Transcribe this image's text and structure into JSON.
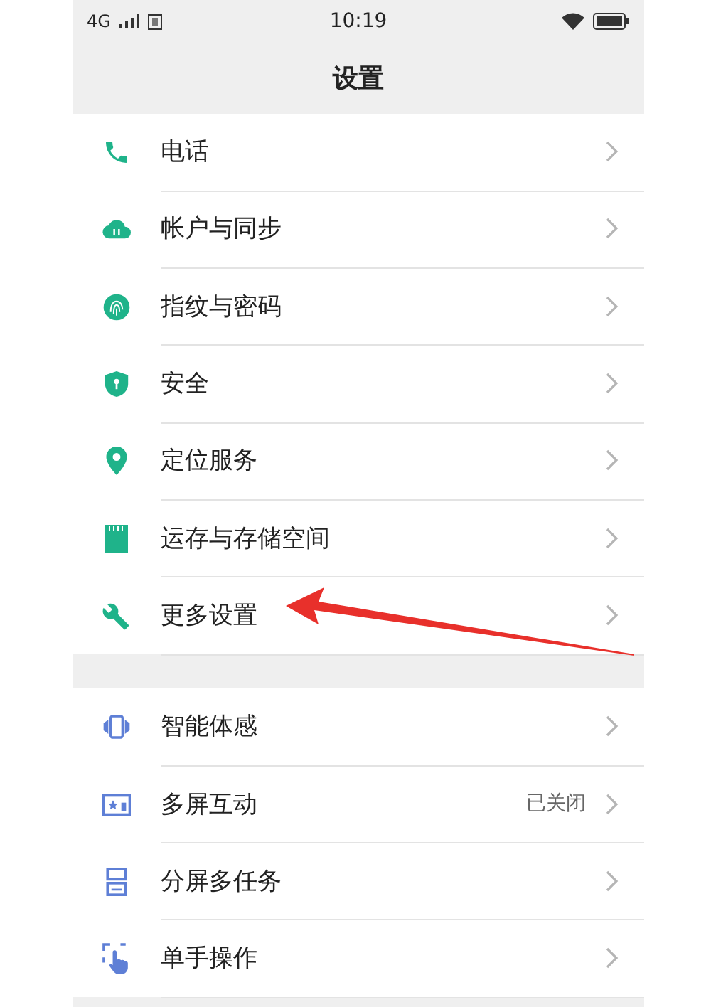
{
  "status_bar": {
    "network": "4G",
    "time": "10:19"
  },
  "title": "设置",
  "groups": [
    {
      "items": [
        {
          "label": "电话"
        },
        {
          "label": "帐户与同步"
        },
        {
          "label": "指纹与密码"
        },
        {
          "label": "安全"
        },
        {
          "label": "定位服务"
        },
        {
          "label": "运存与存储空间"
        },
        {
          "label": "更多设置"
        }
      ]
    },
    {
      "items": [
        {
          "label": "智能体感"
        },
        {
          "label": "多屏互动",
          "value": "已关闭"
        },
        {
          "label": "分屏多任务"
        },
        {
          "label": "单手操作"
        }
      ]
    }
  ]
}
